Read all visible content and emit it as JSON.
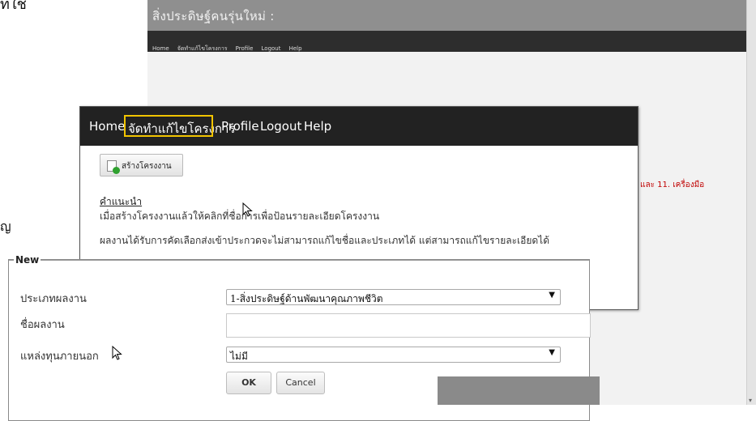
{
  "stray": {
    "top_fragment": "ที่ใช้",
    "left_fragment": "ญ"
  },
  "background_page": {
    "title": "สิ่งประดิษฐ์คนรุ่นใหม่ :",
    "nav": [
      "Home",
      "จัดทำแก้ไขโครงการ",
      "Profile",
      "Logout",
      "Help"
    ],
    "side_text": "และ  11.  เครื่องมือ"
  },
  "zoom_panel": {
    "nav": {
      "home": "Home",
      "manage": "จัดทำแก้ไขโครงการ",
      "profile": "Profile",
      "logout": "Logout",
      "help": "Help"
    },
    "highlight_color": "#f2c400",
    "create_button": "สร้างโครงงาน",
    "help_heading": "คำแนะนำ",
    "help_line1": "เมื่อสร้างโครงงานแล้วให้คลิกที่ชื่อการเพื่อป้อนรายละเอียดโครงงาน",
    "help_line2": "ผลงานได้รับการคัดเลือกส่งเข้าประกวดจะไม่สามารถแก้ไขชื่อและประเภทได้ แต่สามารถแก้ไขรายละเอียดได้"
  },
  "form": {
    "legend": "New",
    "type_label": "ประเภทผลงาน",
    "type_value": "1-สิ่งประดิษฐ์ด้านพัฒนาคุณภาพชีวิต",
    "name_label": "ชื่อผลงาน",
    "name_value": "",
    "funding_label": "แหล่งทุนภายนอก",
    "funding_value": "ไม่มี",
    "ok_label": "OK",
    "cancel_label": "Cancel",
    "dropdown_icon": "triangle-down-icon"
  }
}
